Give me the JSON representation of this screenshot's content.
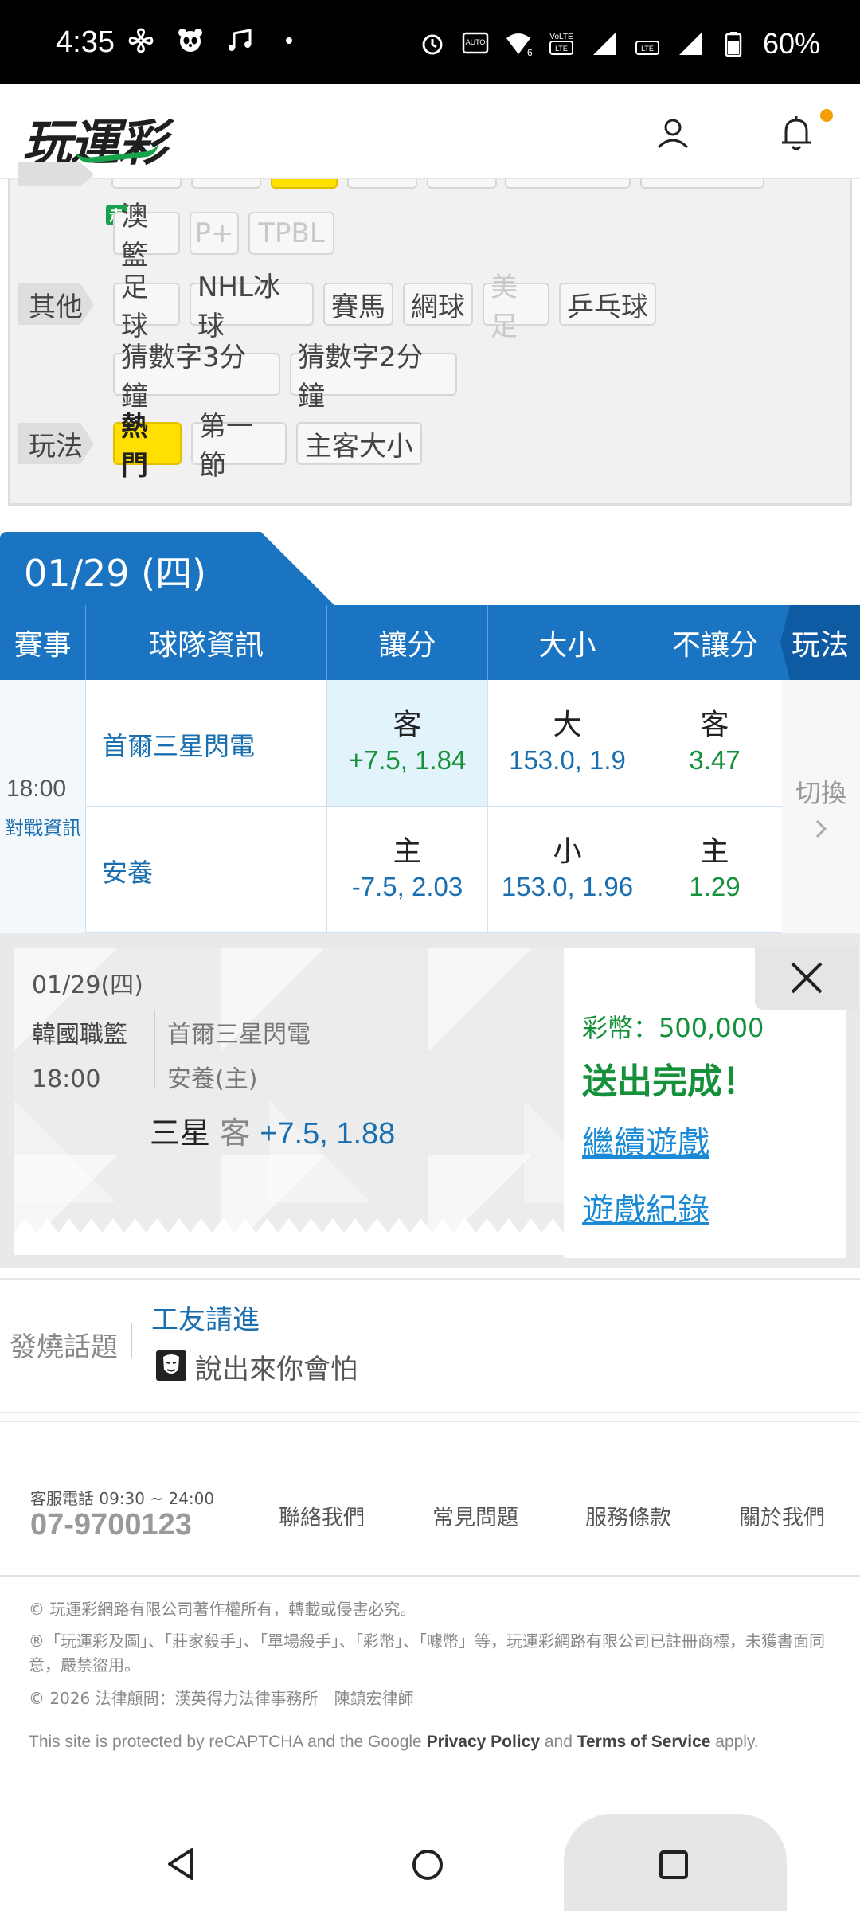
{
  "status_bar": {
    "time": "4:35",
    "battery": "60%",
    "icons_left": [
      "pinwheel-icon",
      "panda-icon",
      "music-note-icon",
      "dot-icon"
    ],
    "icons_right": [
      "alarm-icon",
      "auto-hz-icon",
      "wifi-6-icon",
      "volte-1-icon",
      "signal-icon",
      "volte-2-icon",
      "signal-icon",
      "battery-icon"
    ],
    "sim1": "1",
    "sim2": "2"
  },
  "header": {
    "logo_text": "玩運彩",
    "notification_dot_color": "#f59e0b"
  },
  "filters": {
    "row_basketball_extra": {
      "badge": "走",
      "tags": [
        {
          "label": "澳籃",
          "state": "normal"
        },
        {
          "label": "P+",
          "state": "disabled"
        },
        {
          "label": "TPBL",
          "state": "disabled"
        }
      ]
    },
    "other": {
      "label": "其他",
      "tags": [
        {
          "label": "足球",
          "state": "normal"
        },
        {
          "label": "NHL冰球",
          "state": "normal"
        },
        {
          "label": "賽馬",
          "state": "normal"
        },
        {
          "label": "網球",
          "state": "normal"
        },
        {
          "label": "美足",
          "state": "disabled"
        },
        {
          "label": "乒乓球",
          "state": "normal"
        },
        {
          "label": "猜數字3分鐘",
          "state": "normal"
        },
        {
          "label": "猜數字2分鐘",
          "state": "normal"
        }
      ]
    },
    "play": {
      "label": "玩法",
      "tags": [
        {
          "label": "熱門",
          "state": "active"
        },
        {
          "label": "第一節",
          "state": "normal"
        },
        {
          "label": "主客大小",
          "state": "normal"
        }
      ]
    }
  },
  "date_tab": "01/29 (四)",
  "table": {
    "headers": {
      "event": "賽事",
      "team_info": "球隊資訊",
      "spread": "讓分",
      "total": "大小",
      "moneyline": "不讓分",
      "play": "玩法"
    },
    "game": {
      "time": "18:00",
      "matchup_link": "對戰資訊",
      "switch_label": "切換",
      "away": {
        "team": "首爾三星閃電",
        "spread_side": "客",
        "spread_value": "+7.5, 1.84",
        "total_side": "大",
        "total_value": "153.0, 1.9",
        "ml_side": "客",
        "ml_value": "3.47"
      },
      "home": {
        "team": "安養",
        "spread_side": "主",
        "spread_value": "-7.5, 2.03",
        "total_side": "小",
        "total_value": "153.0, 1.96",
        "ml_side": "主",
        "ml_value": "1.29"
      }
    }
  },
  "bet_slip": {
    "date": "01/29(四)",
    "league": "韓國職籃",
    "time": "18:00",
    "away_team": "首爾三星閃電",
    "home_team": "安養(主)",
    "pick_team": "三星",
    "pick_side": "客",
    "pick_value": "+7.5, 1.88",
    "coins_label": "彩幣：500,000",
    "success": "送出完成！",
    "continue_link": "繼續遊戲",
    "history_link": "遊戲紀錄"
  },
  "hot_topic": {
    "label": "發燒話題",
    "title": "工友請進",
    "subtitle": "說出來你會怕"
  },
  "footer": {
    "hotline_label": "客服電話 09:30 ~ 24:00",
    "hotline_number": "07-9700123",
    "links": [
      "聯絡我們",
      "常見問題",
      "服務條款",
      "關於我們"
    ],
    "copyright": "© 玩運彩網路有限公司著作權所有，轉載或侵害必究。",
    "trademark": "®「玩運彩及圖」、「莊家殺手」、「單場殺手」、「彩幣」、「噱幣」等，玩運彩網路有限公司已註冊商標，未獲書面同意，嚴禁盜用。",
    "legal_counsel": "© 2026 法律顧問：漢英得力法律事務所　陳鎮宏律師",
    "recaptcha_pre": "This site is protected by reCAPTCHA and the Google ",
    "privacy": "Privacy Policy",
    "and": " and ",
    "terms": "Terms of Service",
    "apply": " apply."
  }
}
